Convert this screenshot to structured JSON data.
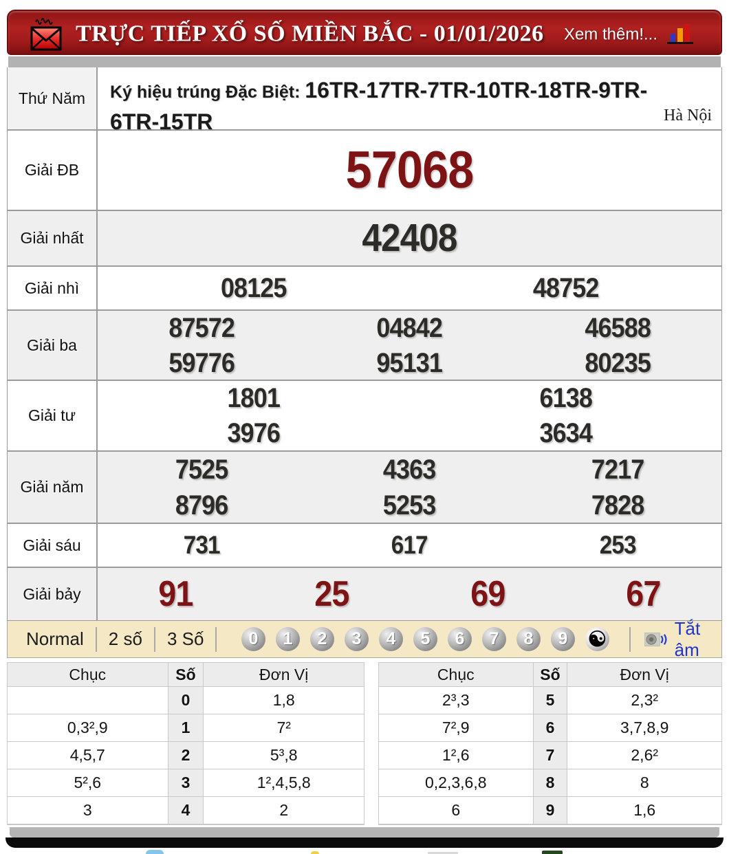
{
  "header": {
    "title": "TRỰC TIẾP XỔ SỐ MIỀN BẮC - 01/01/2026",
    "more": "Xem thêm!..."
  },
  "info": {
    "day": "Thứ Năm",
    "sign_label": "Ký hiệu trúng Đặc Biệt: ",
    "sign_value": "16TR-17TR-7TR-10TR-18TR-9TR-6TR-15TR",
    "region": "Hà Nội"
  },
  "prizes": [
    {
      "label": "Giải ĐB",
      "values": [
        "57068"
      ]
    },
    {
      "label": "Giải nhất",
      "values": [
        "42408"
      ]
    },
    {
      "label": "Giải nhì",
      "values": [
        "08125",
        "48752"
      ]
    },
    {
      "label": "Giải ba",
      "values": [
        "87572",
        "04842",
        "46588",
        "59776",
        "95131",
        "80235"
      ]
    },
    {
      "label": "Giải tư",
      "values": [
        "1801",
        "6138",
        "3976",
        "3634"
      ]
    },
    {
      "label": "Giải năm",
      "values": [
        "7525",
        "4363",
        "7217",
        "8796",
        "5253",
        "7828"
      ]
    },
    {
      "label": "Giải sáu",
      "values": [
        "731",
        "617",
        "253"
      ]
    },
    {
      "label": "Giải bảy",
      "values": [
        "91",
        "25",
        "69",
        "67"
      ]
    }
  ],
  "controls": {
    "modes": [
      "Normal",
      "2 số",
      "3 Số"
    ],
    "balls": [
      "0",
      "1",
      "2",
      "3",
      "4",
      "5",
      "6",
      "7",
      "8",
      "9"
    ],
    "yinyang": "☯",
    "mute": "Tắt âm"
  },
  "summary": {
    "headers": [
      "Chục",
      "Số",
      "Đơn Vị"
    ],
    "left": [
      [
        "",
        "0",
        "1,8"
      ],
      [
        "0,3²,9",
        "1",
        "7²"
      ],
      [
        "4,5,7",
        "2",
        "5³,8"
      ],
      [
        "5²,6",
        "3",
        "1²,4,5,8"
      ],
      [
        "3",
        "4",
        "2"
      ]
    ],
    "right": [
      [
        "2³,3",
        "5",
        "2,3²"
      ],
      [
        "7²,9",
        "6",
        "3,7,8,9"
      ],
      [
        "1²,6",
        "7",
        "2,6²"
      ],
      [
        "0,2,3,6,8",
        "8",
        "8"
      ],
      [
        "6",
        "9",
        "1,6"
      ]
    ]
  },
  "colors": {
    "header_red": "#a81d1d",
    "prize_red": "#7e1315",
    "mute_blue": "#1f35cf",
    "control_beige": "#f5e8c5"
  }
}
